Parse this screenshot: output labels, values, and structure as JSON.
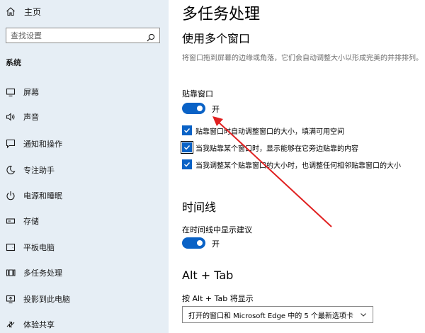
{
  "sidebar": {
    "home_label": "主页",
    "search_placeholder": "查找设置",
    "section_label": "系统",
    "items": [
      {
        "label": "屏幕",
        "icon": "monitor-icon"
      },
      {
        "label": "声音",
        "icon": "speaker-icon"
      },
      {
        "label": "通知和操作",
        "icon": "notification-icon"
      },
      {
        "label": "专注助手",
        "icon": "moon-icon"
      },
      {
        "label": "电源和睡眠",
        "icon": "power-icon"
      },
      {
        "label": "存储",
        "icon": "storage-icon"
      },
      {
        "label": "平板电脑",
        "icon": "tablet-icon"
      },
      {
        "label": "多任务处理",
        "icon": "multitasking-icon"
      },
      {
        "label": "投影到此电脑",
        "icon": "projecting-icon"
      },
      {
        "label": "体验共享",
        "icon": "shared-experiences-icon"
      }
    ]
  },
  "main": {
    "title": "多任务处理",
    "snap": {
      "heading": "使用多个窗口",
      "description": "将窗口拖到屏幕的边缘或角落，它们会自动调整大小以形成完美的并排排列。",
      "toggle_label": "贴靠窗口",
      "toggle_state": "开",
      "options": [
        {
          "label": "贴靠窗口时自动调整窗口的大小，填满可用空间",
          "checked": true
        },
        {
          "label": "当我贴靠某个窗口时，显示能够在它旁边贴靠的内容",
          "checked": true
        },
        {
          "label": "当我调整某个贴靠窗口的大小时，也调整任何相邻贴靠窗口的大小",
          "checked": true
        }
      ]
    },
    "timeline": {
      "heading": "时间线",
      "toggle_label": "在时间线中显示建议",
      "toggle_state": "开"
    },
    "alttab": {
      "heading": "Alt + Tab",
      "label": "按 Alt + Tab 将显示",
      "selected": "打开的窗口和 Microsoft Edge 中的 5 个最新选项卡"
    }
  },
  "colors": {
    "accent": "#0a62c6",
    "sidebar_bg": "#e6eef5",
    "annotation_arrow": "#e02020"
  }
}
